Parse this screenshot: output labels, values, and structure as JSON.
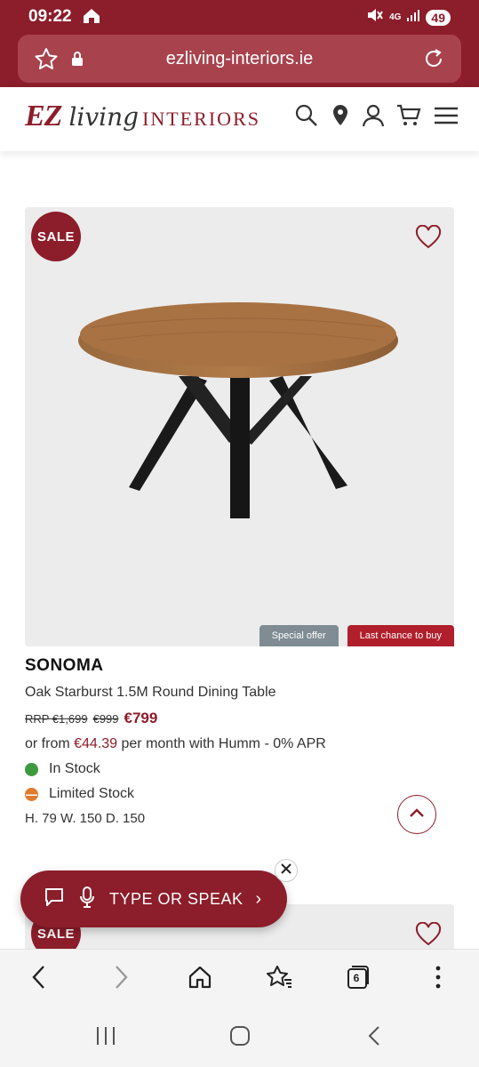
{
  "status": {
    "time": "09:22",
    "network": "4G",
    "battery": "49"
  },
  "browser": {
    "url": "ezliving-interiors.ie",
    "tab_count": "6"
  },
  "site": {
    "logo_ez": "EZ",
    "logo_living": "living",
    "logo_interiors": "INTERIORS"
  },
  "product": {
    "sale_badge": "SALE",
    "badge_offer": "Special offer",
    "badge_last": "Last chance to buy",
    "name": "SONOMA",
    "description": "Oak Starburst 1.5M Round Dining Table",
    "rrp": "RRP €1,699",
    "was_price": "€999",
    "price": "€799",
    "finance_prefix": "or from ",
    "finance_amount": "€44.39",
    "finance_suffix": " per month with Humm - 0% APR",
    "stock_status": "In Stock",
    "stock_level": "Limited Stock",
    "dimensions": "H. 79  W. 150  D. 150"
  },
  "next_product": {
    "sale_badge": "SALE"
  },
  "voice_assist": {
    "label": "TYPE OR SPEAK",
    "chevron": "›"
  },
  "colors": {
    "brand": "#8c1d2a",
    "offer_badge": "#7f8c93",
    "last_chance_badge": "#b01f2b",
    "in_stock": "#3e9a3e",
    "limited_stock": "#e07a2f"
  },
  "icons": [
    "home-icon",
    "mute-icon",
    "signal-icon",
    "star-icon",
    "lock-icon",
    "reload-icon",
    "search-icon",
    "location-pin-icon",
    "account-icon",
    "cart-icon",
    "menu-icon",
    "heart-icon",
    "chevron-up-icon",
    "chat-icon",
    "mic-icon",
    "close-icon",
    "back-icon",
    "forward-icon",
    "home-icon",
    "bookmarks-icon",
    "tabs-icon",
    "more-icon",
    "recents-icon",
    "home-circle-icon",
    "nav-back-icon"
  ]
}
